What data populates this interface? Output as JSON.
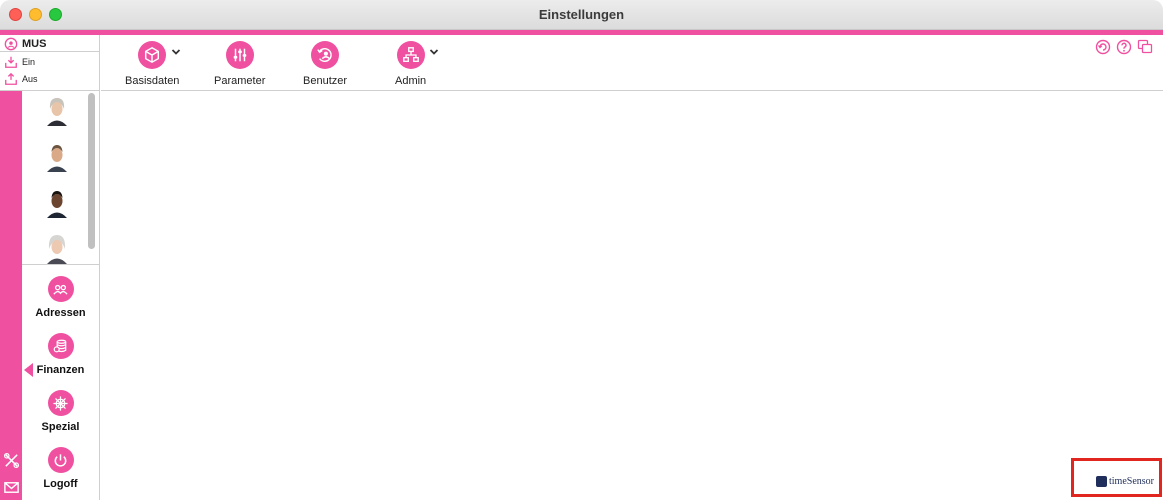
{
  "window": {
    "title": "Einstellungen"
  },
  "user": {
    "code": "MUS",
    "ein_label": "Ein",
    "aus_label": "Aus"
  },
  "toolbar": {
    "items": [
      {
        "label": "Basisdaten",
        "icon": "cube-icon"
      },
      {
        "label": "Parameter",
        "icon": "sliders-icon"
      },
      {
        "label": "Benutzer",
        "icon": "user-circle-icon"
      },
      {
        "label": "Admin",
        "icon": "network-icon"
      }
    ],
    "corner_icons": [
      "refresh-icon",
      "help-icon",
      "windows-icon"
    ]
  },
  "sidebar": {
    "nav": [
      {
        "label": "Adressen",
        "icon": "people-icon"
      },
      {
        "label": "Finanzen",
        "icon": "coins-icon"
      },
      {
        "label": "Spezial",
        "icon": "helm-icon"
      },
      {
        "label": "Logoff",
        "icon": "power-icon"
      }
    ]
  },
  "brand": {
    "logo_text": "timeSensor"
  },
  "colors": {
    "accent": "#f050a0",
    "highlight_box": "#e0261f"
  }
}
